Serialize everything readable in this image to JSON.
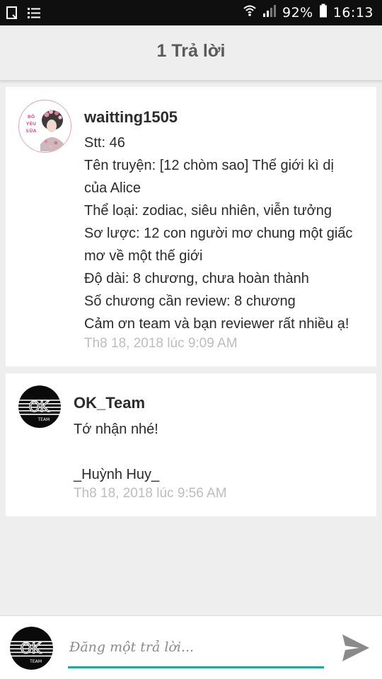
{
  "status_bar": {
    "left_icons": [
      "screenshot-icon",
      "menu-list-icon"
    ],
    "battery_percent": "92%",
    "time": "16:13"
  },
  "header": {
    "title": "1 Trả lời"
  },
  "posts": [
    {
      "username": "waitting1505",
      "lines": [
        "Stt: 46",
        "Tên truyện: [12 chòm sao] Thế giới kì dị",
        "của Alice",
        "Thể loại: zodiac, siêu nhiên, viễn tưởng",
        "Sơ lược: 12 con người mơ chung một giấc",
        "mơ về một thế giới",
        "Độ dài: 8 chương, chưa hoàn thành",
        "Số chương cần review: 8 chương",
        "Cảm ơn team và bạn reviewer rất nhiều ạ!"
      ],
      "timestamp": "Th8 18, 2018 lúc 9:09 AM",
      "avatar_text": [
        "BÔ",
        "YÊU",
        "SỮA"
      ]
    },
    {
      "username": "OK_Team",
      "lines": [
        "Tớ nhận nhé!",
        "",
        "_Huỳnh Huy_"
      ],
      "timestamp": "Th8 18, 2018 lúc 9:56 AM",
      "avatar_text": [
        "OK",
        "TEAM"
      ]
    }
  ],
  "composer": {
    "placeholder": "Đăng một trả lời...",
    "avatar_text": [
      "OK",
      "TEAM"
    ],
    "send_icon": "send-icon",
    "accent_color": "#26a69a"
  }
}
